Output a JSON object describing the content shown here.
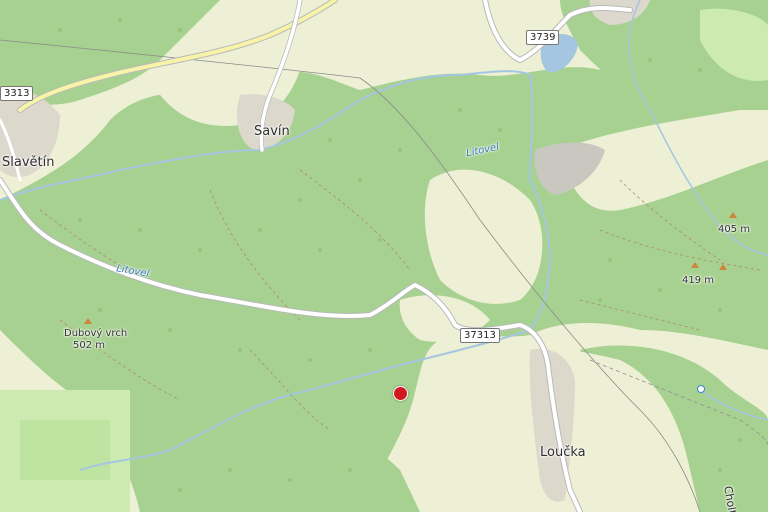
{
  "map": {
    "places": {
      "slavetin": "Slavětín",
      "savin": "Savín",
      "loucka": "Loučka",
      "cholt": "Cholt"
    },
    "river_labels": [
      "Litovel",
      "Litovel"
    ],
    "roads": {
      "r3313": "3313",
      "r3739": "3739",
      "r37313": "37313"
    },
    "peaks": {
      "dubovy_name": "Dubový vrch",
      "dubovy_elev": "502 m",
      "p405": "405 m",
      "p419": "419 m"
    },
    "colors": {
      "forest": "#a7d190",
      "meadow": "#eef0d5",
      "farmland": "#f2efd9",
      "grass": "#cdebb0",
      "water": "#a5c6e0",
      "road": "#ffffff",
      "primary_road": "#f7f4a8",
      "marker": "#d0191f"
    }
  }
}
